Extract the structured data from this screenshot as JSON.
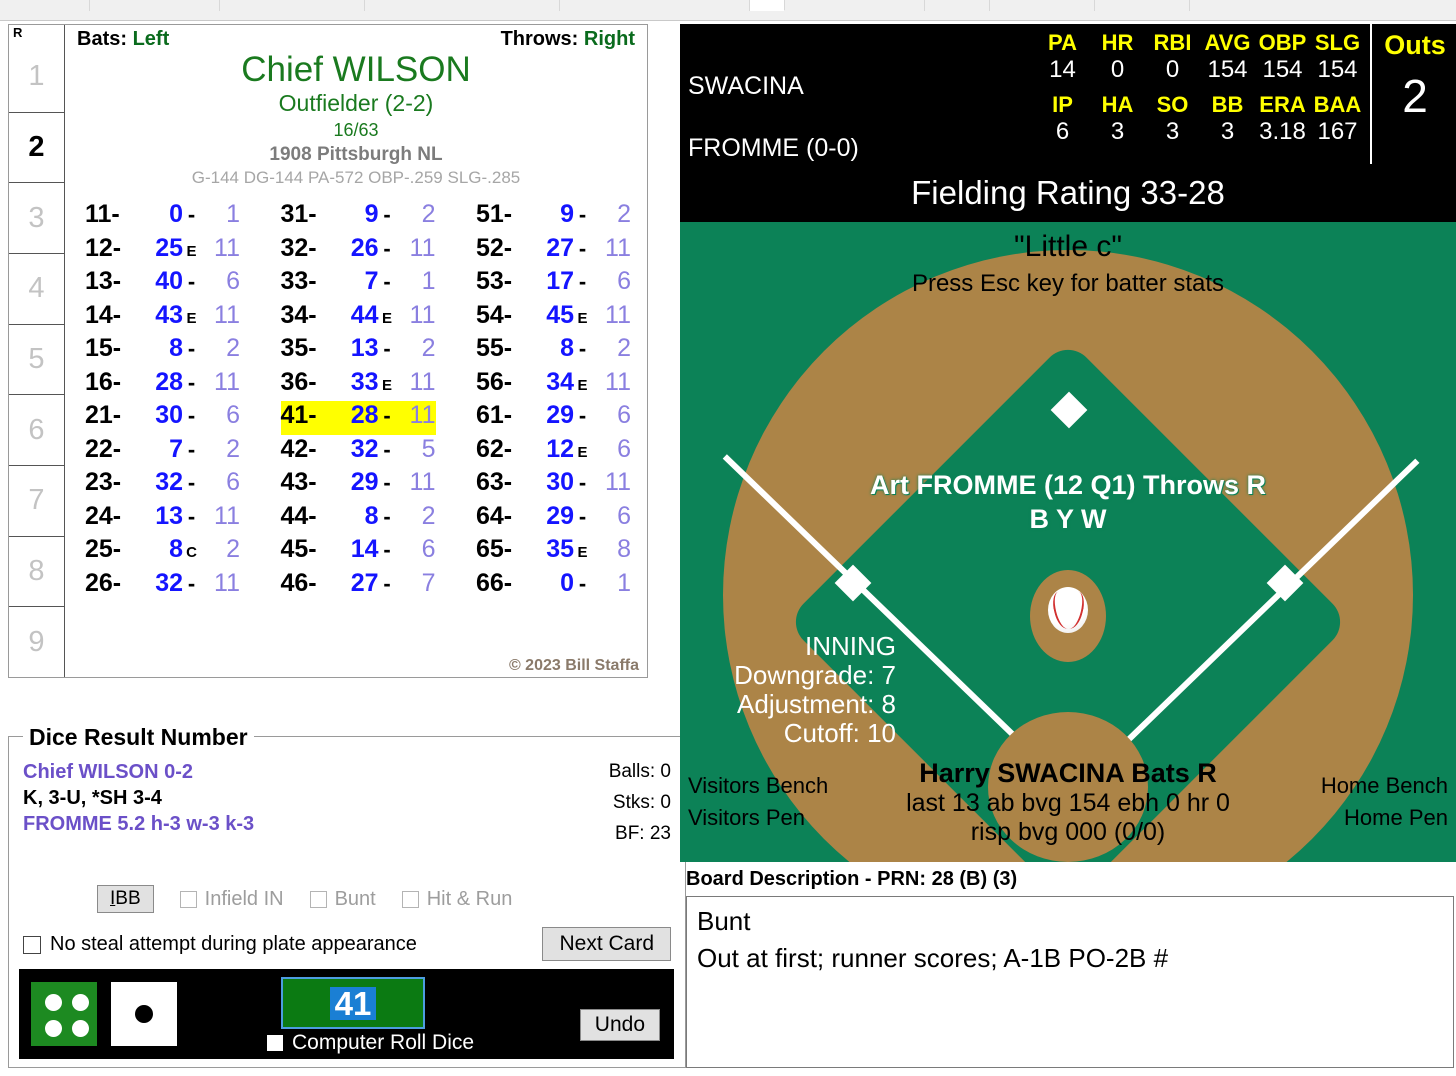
{
  "menu": {
    "items": [
      {
        "label": "",
        "selected": false
      },
      {
        "label": "",
        "selected": false
      },
      {
        "label": "",
        "selected": false
      },
      {
        "label": "",
        "selected": false
      },
      {
        "label": "",
        "selected": false
      },
      {
        "label": "",
        "selected": true
      },
      {
        "label": "",
        "selected": false
      },
      {
        "label": "",
        "selected": false
      },
      {
        "label": "",
        "selected": false
      },
      {
        "label": "",
        "selected": false
      }
    ]
  },
  "card": {
    "inning_header": "R",
    "innings": [
      "1",
      "2",
      "3",
      "4",
      "5",
      "6",
      "7",
      "8",
      "9"
    ],
    "active_inning": "2",
    "bats_label": "Bats:",
    "bats_value": "Left",
    "throws_label": "Throws:",
    "throws_value": "Right",
    "player_name": "Chief WILSON",
    "position": "Outfielder (2-2)",
    "fraction": "16/63",
    "team": "1908 Pittsburgh NL",
    "stat_line": "G-144 DG-144 PA-572 OBP-.259 SLG-.285",
    "copyright": "© 2023 Bill Staffa",
    "highlight_key": "41",
    "columns": [
      [
        {
          "key": "11-",
          "value": "0",
          "mark": "-",
          "count": "1"
        },
        {
          "key": "12-",
          "value": "25",
          "mark": "E",
          "count": "11"
        },
        {
          "key": "13-",
          "value": "40",
          "mark": "-",
          "count": "6"
        },
        {
          "key": "14-",
          "value": "43",
          "mark": "E",
          "count": "11"
        },
        {
          "key": "15-",
          "value": "8",
          "mark": "-",
          "count": "2"
        },
        {
          "key": "16-",
          "value": "28",
          "mark": "-",
          "count": "11"
        },
        {
          "key": "21-",
          "value": "30",
          "mark": "-",
          "count": "6"
        },
        {
          "key": "22-",
          "value": "7",
          "mark": "-",
          "count": "2"
        },
        {
          "key": "23-",
          "value": "32",
          "mark": "-",
          "count": "6"
        },
        {
          "key": "24-",
          "value": "13",
          "mark": "-",
          "count": "11"
        },
        {
          "key": "25-",
          "value": "8",
          "mark": "C",
          "count": "2"
        },
        {
          "key": "26-",
          "value": "32",
          "mark": "-",
          "count": "11"
        }
      ],
      [
        {
          "key": "31-",
          "value": "9",
          "mark": "-",
          "count": "2"
        },
        {
          "key": "32-",
          "value": "26",
          "mark": "-",
          "count": "11"
        },
        {
          "key": "33-",
          "value": "7",
          "mark": "-",
          "count": "1"
        },
        {
          "key": "34-",
          "value": "44",
          "mark": "E",
          "count": "11"
        },
        {
          "key": "35-",
          "value": "13",
          "mark": "-",
          "count": "2"
        },
        {
          "key": "36-",
          "value": "33",
          "mark": "E",
          "count": "11"
        },
        {
          "key": "41-",
          "value": "28",
          "mark": "-",
          "count": "11"
        },
        {
          "key": "42-",
          "value": "32",
          "mark": "-",
          "count": "5"
        },
        {
          "key": "43-",
          "value": "29",
          "mark": "-",
          "count": "11"
        },
        {
          "key": "44-",
          "value": "8",
          "mark": "-",
          "count": "2"
        },
        {
          "key": "45-",
          "value": "14",
          "mark": "-",
          "count": "6"
        },
        {
          "key": "46-",
          "value": "27",
          "mark": "-",
          "count": "7"
        }
      ],
      [
        {
          "key": "51-",
          "value": "9",
          "mark": "-",
          "count": "2"
        },
        {
          "key": "52-",
          "value": "27",
          "mark": "-",
          "count": "11"
        },
        {
          "key": "53-",
          "value": "17",
          "mark": "-",
          "count": "6"
        },
        {
          "key": "54-",
          "value": "45",
          "mark": "E",
          "count": "11"
        },
        {
          "key": "55-",
          "value": "8",
          "mark": "-",
          "count": "2"
        },
        {
          "key": "56-",
          "value": "34",
          "mark": "E",
          "count": "11"
        },
        {
          "key": "61-",
          "value": "29",
          "mark": "-",
          "count": "6"
        },
        {
          "key": "62-",
          "value": "12",
          "mark": "E",
          "count": "6"
        },
        {
          "key": "63-",
          "value": "30",
          "mark": "-",
          "count": "11"
        },
        {
          "key": "64-",
          "value": "29",
          "mark": "-",
          "count": "6"
        },
        {
          "key": "65-",
          "value": "35",
          "mark": "E",
          "count": "8"
        },
        {
          "key": "66-",
          "value": "0",
          "mark": "-",
          "count": "1"
        }
      ]
    ]
  },
  "dice_panel": {
    "title": "Dice Result Number",
    "line1": "Chief WILSON  0-2",
    "line2": "K, 3-U, *SH 3-4",
    "line3": "FROMME  5.2  h-3  w-3  k-3",
    "balls": "Balls: 0",
    "strikes": "Stks: 0",
    "bf": "BF: 23",
    "ibb_button": "IBB",
    "ibb_accel": "I",
    "infield_in": "Infield IN",
    "bunt": "Bunt",
    "hit_and_run": "Hit & Run",
    "no_steal": "No steal attempt during plate appearance",
    "next_card": "Next Card",
    "computer_roll": "Computer Roll Dice",
    "undo": "Undo",
    "roll_value": "41",
    "die_green_pips": 4,
    "die_white_pips": 1
  },
  "scoreboard": {
    "batter_name": "SWACINA",
    "pitcher_name": "FROMME (0-0)",
    "batter_headers": [
      "PA",
      "HR",
      "RBI",
      "AVG",
      "OBP",
      "SLG"
    ],
    "batter_values": [
      "14",
      "0",
      "0",
      "154",
      "154",
      "154"
    ],
    "pitcher_headers": [
      "IP",
      "HA",
      "SO",
      "BB",
      "ERA",
      "BAA"
    ],
    "pitcher_values": [
      "6",
      "3",
      "3",
      "3",
      "3.18",
      "167"
    ],
    "outs_label": "Outs",
    "outs_value": "2"
  },
  "fielding": {
    "rating": "Fielding Rating 33-28"
  },
  "field": {
    "little_c": "\"Little c\"",
    "esc_hint": "Press Esc key for batter stats",
    "pitcher_line": "Art FROMME (12 Q1) Throws R",
    "pitcher_sub": "B Y W",
    "inning_label": "INNING",
    "downgrade": "Downgrade: 7",
    "adjustment": "Adjustment: 8",
    "cutoff": "Cutoff: 10",
    "batter_line1": "Harry SWACINA Bats R",
    "batter_line2": "last 13 ab bvg 154 ebh 0 hr 0",
    "batter_line3": "risp bvg 000 (0/0)",
    "visitors_bench": "Visitors Bench",
    "visitors_pen": "Visitors Pen",
    "home_bench": "Home Bench",
    "home_pen": "Home Pen"
  },
  "board": {
    "label": "Board Description - PRN: 28 (B) (3)",
    "line1": "Bunt",
    "line2": "Out at first; runner scores; A-1B PO-2B #"
  },
  "colors": {
    "grass": "#0c8257",
    "dirt": "#ac8447",
    "highlight": "#ffff00",
    "card_green": "#1a7a1f",
    "roll_blue": "#1414ff",
    "count_purple": "#8a7fe0",
    "accent_yellow": "#ffff00"
  }
}
